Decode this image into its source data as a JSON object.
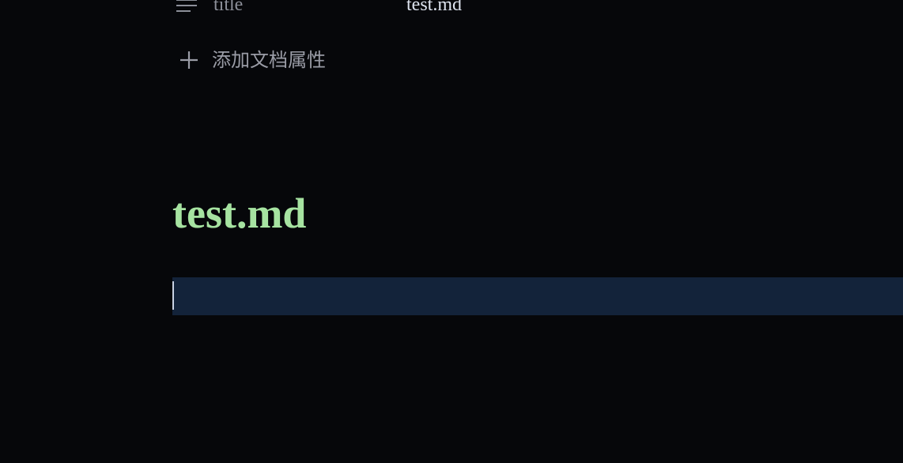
{
  "properties": {
    "rows": [
      {
        "icon": "text-lines-icon",
        "key": "title",
        "value": "test.md"
      }
    ],
    "add_label": "添加文档属性",
    "add_icon": "plus-icon"
  },
  "document": {
    "title": "test.md"
  },
  "colors": {
    "background": "#06070a",
    "title": "#a6e3a1",
    "active_block": "#13233a",
    "muted_text": "#9a9ca6",
    "value_text": "#dde3ee"
  }
}
